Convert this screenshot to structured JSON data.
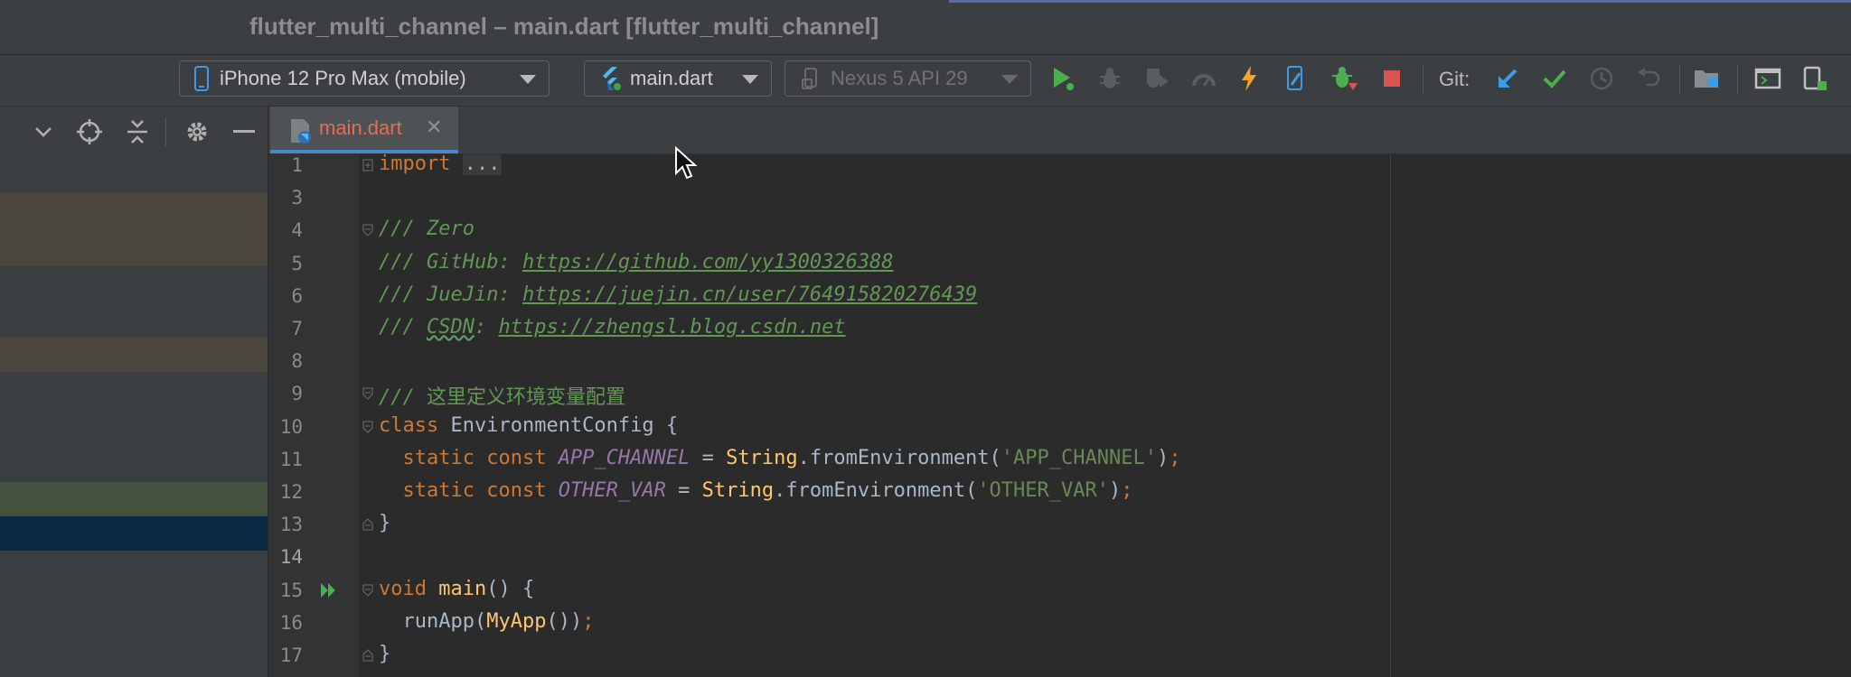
{
  "window": {
    "title": "flutter_multi_channel – main.dart [flutter_multi_channel]"
  },
  "toolbar": {
    "device_selector": "iPhone 12 Pro Max (mobile)",
    "run_config": "main.dart",
    "emulator_selector": "Nexus 5 API 29",
    "git_label": "Git:"
  },
  "editor_tabs": [
    {
      "label": "main.dart",
      "close": "✕"
    }
  ],
  "code": {
    "lines": [
      {
        "n": "1",
        "parts": [
          [
            "kw",
            "import"
          ],
          [
            "p",
            " "
          ],
          [
            "ell",
            "..."
          ]
        ]
      },
      {
        "n": "3",
        "parts": []
      },
      {
        "n": "4",
        "parts": [
          [
            "cm",
            "/// Zero"
          ]
        ]
      },
      {
        "n": "5",
        "parts": [
          [
            "cm",
            "/// GitHub: "
          ],
          [
            "link",
            "https://github.com/yy1300326388"
          ]
        ]
      },
      {
        "n": "6",
        "parts": [
          [
            "cm",
            "/// JueJin: "
          ],
          [
            "link",
            "https://juejin.cn/user/764915820276439"
          ]
        ]
      },
      {
        "n": "7",
        "parts": [
          [
            "cm",
            "/// "
          ],
          [
            "cmtypo",
            "CSDN"
          ],
          [
            "cm",
            ": "
          ],
          [
            "link",
            "https://zhengsl.blog.csdn.net"
          ]
        ]
      },
      {
        "n": "8",
        "parts": []
      },
      {
        "n": "9",
        "parts": [
          [
            "cm",
            "/// "
          ],
          [
            "cmcn",
            "这里定义环境变量配置"
          ]
        ]
      },
      {
        "n": "10",
        "parts": [
          [
            "kw",
            "class "
          ],
          [
            "cls",
            "EnvironmentConfig {"
          ]
        ]
      },
      {
        "n": "11",
        "parts": [
          [
            "p",
            "  "
          ],
          [
            "kw",
            "static const "
          ],
          [
            "fld",
            "APP_CHANNEL"
          ],
          [
            "p",
            " = "
          ],
          [
            "fn",
            "String"
          ],
          [
            "p",
            "."
          ],
          [
            "p",
            "fromEnvironment("
          ],
          [
            "str",
            "'APP_CHANNEL'"
          ],
          [
            "p",
            ")"
          ],
          [
            "kw",
            ";"
          ]
        ]
      },
      {
        "n": "12",
        "parts": [
          [
            "p",
            "  "
          ],
          [
            "kw",
            "static const "
          ],
          [
            "fld",
            "OTHER_VAR"
          ],
          [
            "p",
            " = "
          ],
          [
            "fn",
            "String"
          ],
          [
            "p",
            "."
          ],
          [
            "p",
            "fromEnvironment("
          ],
          [
            "str",
            "'OTHER_VAR'"
          ],
          [
            "p",
            ")"
          ],
          [
            "kw",
            ";"
          ]
        ]
      },
      {
        "n": "13",
        "parts": [
          [
            "p",
            "}"
          ]
        ]
      },
      {
        "n": "14",
        "parts": []
      },
      {
        "n": "15",
        "parts": [
          [
            "kw",
            "void "
          ],
          [
            "fn",
            "main"
          ],
          [
            "p",
            "() {"
          ]
        ]
      },
      {
        "n": "16",
        "parts": [
          [
            "p",
            "  runApp("
          ],
          [
            "fn",
            "MyApp"
          ],
          [
            "p",
            "())"
          ],
          [
            "kw",
            ";"
          ]
        ]
      },
      {
        "n": "17",
        "parts": [
          [
            "p",
            "}"
          ]
        ]
      }
    ]
  },
  "colors": {
    "background": "#2b2b2b",
    "panel": "#3c3f41",
    "gutter": "#313335",
    "keyword": "#cc7832",
    "comment": "#629755",
    "string": "#6a8759",
    "field": "#9876aa",
    "function": "#ffc66d",
    "tab_accent": "#4a88c7",
    "tab_text_modified": "#e06e54"
  },
  "icons": {
    "toolbar": [
      "phone-icon",
      "flutter-icon",
      "android-device-icon",
      "run-icon",
      "debug-icon",
      "coverage-icon",
      "profile-icon",
      "hot-reload-icon",
      "device-file-icon",
      "attach-debugger-icon",
      "stop-icon",
      "git-update-icon",
      "git-commit-icon",
      "git-history-icon",
      "git-rollback-icon",
      "project-structure-icon",
      "terminal-icon",
      "device-manager-icon"
    ],
    "left_panel": [
      "chevron-down-icon",
      "locate-icon",
      "collapse-all-icon",
      "gear-icon",
      "minimize-icon"
    ],
    "editor": [
      "run-gutter-icon",
      "mouse-cursor-icon"
    ]
  }
}
